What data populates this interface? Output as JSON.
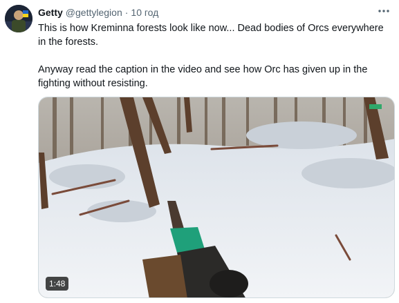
{
  "tweet": {
    "display_name": "Getty",
    "handle": "@gettylegion",
    "separator": "·",
    "time": "10 год",
    "more_icon": "more-horizontal-icon",
    "text_line1": "This is how Kreminna forests look like now... Dead bodies of Orcs everywhere in the forests.",
    "text_line2": "Anyway read the caption in the video and see how Orc has given up in the fighting without resisting.",
    "video_duration": "1:48"
  },
  "colors": {
    "text": "#0f1419",
    "secondary": "#536471",
    "border": "#cfd9de"
  }
}
